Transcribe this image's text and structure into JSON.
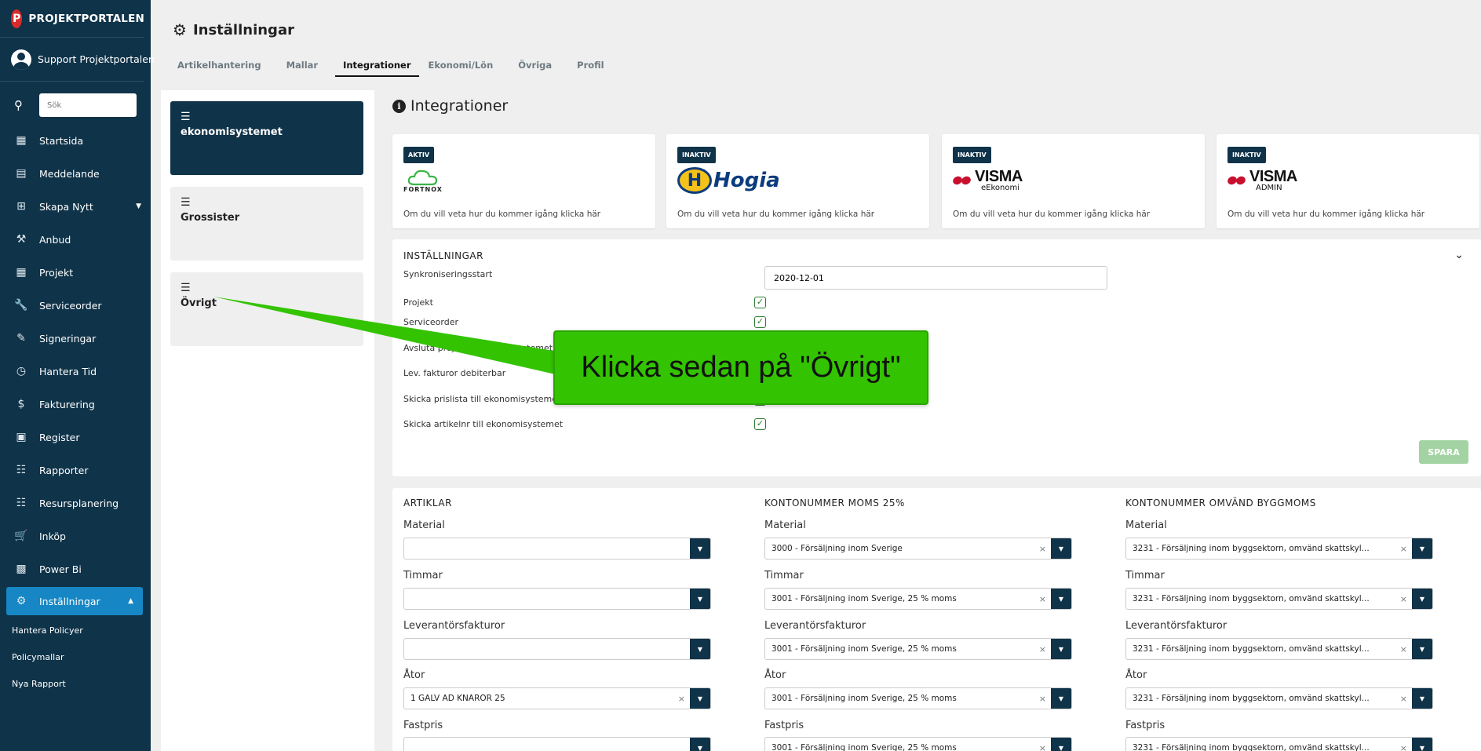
{
  "app": {
    "brand": "PROJEKTPORTALEN",
    "user": "Support Projektportalen"
  },
  "sidebar": {
    "search_placeholder": "Sök",
    "items": [
      {
        "label": "Startsida",
        "icon": "dashboard-icon"
      },
      {
        "label": "Meddelande",
        "icon": "message-icon"
      },
      {
        "label": "Skapa Nytt",
        "icon": "add-box-icon"
      },
      {
        "label": "Anbud",
        "icon": "gavel-icon"
      },
      {
        "label": "Projekt",
        "icon": "dashboard-icon"
      },
      {
        "label": "Serviceorder",
        "icon": "wrench-icon"
      },
      {
        "label": "Signeringar",
        "icon": "pencil-icon"
      },
      {
        "label": "Hantera Tid",
        "icon": "clock-icon"
      },
      {
        "label": "Fakturering",
        "icon": "dollar-icon"
      },
      {
        "label": "Register",
        "icon": "image-icon"
      },
      {
        "label": "Rapporter",
        "icon": "calendar-icon"
      },
      {
        "label": "Resursplanering",
        "icon": "calendar-icon"
      },
      {
        "label": "Inköp",
        "icon": "cart-icon"
      },
      {
        "label": "Power Bi",
        "icon": "chart-icon"
      },
      {
        "label": "Inställningar",
        "icon": "gear-icon"
      }
    ],
    "sub_items": [
      "Hantera Policyer",
      "Policymallar",
      "Nya Rapport"
    ]
  },
  "header": {
    "title": "Inställningar",
    "tabs": [
      "Artikelhantering",
      "Mallar",
      "Integrationer",
      "Ekonomi/Lön",
      "Övriga",
      "Profil"
    ],
    "active_tab": "Integrationer"
  },
  "left_cards": [
    "ekonomisystemet",
    "Grossister",
    "Övrigt"
  ],
  "section": {
    "title": "Integrationer"
  },
  "integrations": [
    {
      "status": "AKTIV",
      "logo_text": "FORTNOX",
      "hint": "Om du vill veta hur du kommer igång klicka här"
    },
    {
      "status": "INAKTIV",
      "logo_text": "Hogia",
      "hint": "Om du vill veta hur du kommer igång klicka här"
    },
    {
      "status": "INAKTIV",
      "logo_text": "VISMA",
      "logo_sub": "eEkonomi",
      "hint": "Om du vill veta hur du kommer igång klicka här"
    },
    {
      "status": "INAKTIV",
      "logo_text": "VISMA",
      "logo_sub": "ADMIN",
      "hint": "Om du vill veta hur du kommer igång klicka här"
    }
  ],
  "settings": {
    "heading": "INSTÄLLNINGAR",
    "sync_label": "Synkroniseringsstart",
    "sync_value": "2020-12-01",
    "rows": [
      "Projekt",
      "Serviceorder",
      "Avsluta projekt i ekonomisystemet",
      "Lev. fakturor debiterbar",
      "Skicka prislista till ekonomisystemet",
      "Skicka artikelnr till ekonomisystemet"
    ],
    "save": "SPARA"
  },
  "accounts": {
    "columns": [
      {
        "heading": "ARTIKLAR",
        "fields": [
          {
            "label": "Material",
            "value": ""
          },
          {
            "label": "Timmar",
            "value": ""
          },
          {
            "label": "Leverantörsfakturor",
            "value": ""
          },
          {
            "label": "Åtor",
            "value": "1 GALV AD KNÄRÖR 25"
          },
          {
            "label": "Fastpris",
            "value": ""
          }
        ]
      },
      {
        "heading": "KONTONUMMER MOMS 25%",
        "fields": [
          {
            "label": "Material",
            "value": "3000 - Försäljning inom Sverige"
          },
          {
            "label": "Timmar",
            "value": "3001 - Försäljning inom Sverige, 25 % moms"
          },
          {
            "label": "Leverantörsfakturor",
            "value": "3001 - Försäljning inom Sverige, 25 % moms"
          },
          {
            "label": "Åtor",
            "value": "3001 - Försäljning inom Sverige, 25 % moms"
          },
          {
            "label": "Fastpris",
            "value": "3001 - Försäljning inom Sverige, 25 % moms"
          }
        ]
      },
      {
        "heading": "KONTONUMMER OMVÄND BYGGMOMS",
        "fields": [
          {
            "label": "Material",
            "value": "3231 - Försäljning inom byggsektorn, omvänd skattskyl..."
          },
          {
            "label": "Timmar",
            "value": "3231 - Försäljning inom byggsektorn, omvänd skattskyl..."
          },
          {
            "label": "Leverantörsfakturor",
            "value": "3231 - Försäljning inom byggsektorn, omvänd skattskyl..."
          },
          {
            "label": "Åtor",
            "value": "3231 - Försäljning inom byggsektorn, omvänd skattskyl..."
          },
          {
            "label": "Fastpris",
            "value": "3231 - Försäljning inom byggsektorn, omvänd skattskyl..."
          }
        ]
      }
    ]
  },
  "callout": {
    "text": "Klicka sedan på \"Övrigt\"",
    "color": "#33c300"
  }
}
